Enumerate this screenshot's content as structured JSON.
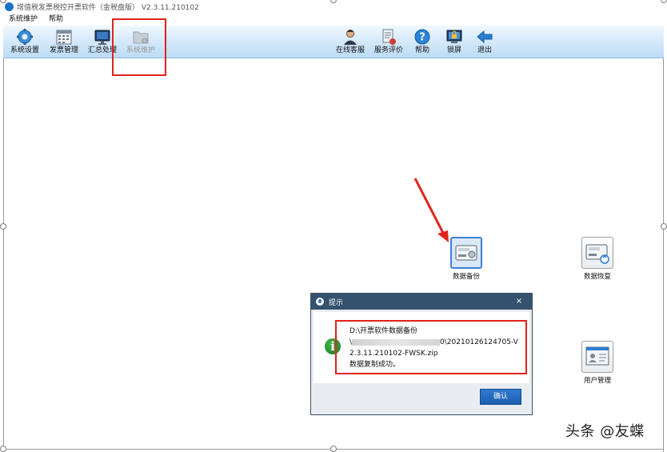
{
  "window": {
    "title": "增值税发票税控开票软件（金税盘版） V2.3.11.210102"
  },
  "menu": [
    {
      "label": "系统维护"
    },
    {
      "label": "帮助"
    }
  ],
  "toolbar": {
    "left": [
      {
        "label": "系统设置",
        "icon": "gear-icon"
      },
      {
        "label": "发票管理",
        "icon": "invoice-calendar-icon"
      },
      {
        "label": "汇总处理",
        "icon": "monitor-icon"
      },
      {
        "label": "系统维护",
        "icon": "folder-icon",
        "disabled": true
      }
    ],
    "right": [
      {
        "label": "在线客服",
        "icon": "support-agent-icon"
      },
      {
        "label": "服务评价",
        "icon": "evaluation-icon"
      },
      {
        "label": "帮助",
        "icon": "help-icon"
      },
      {
        "label": "锁屏",
        "icon": "lock-screen-icon"
      },
      {
        "label": "退出",
        "icon": "exit-arrow-icon"
      }
    ]
  },
  "workspace": {
    "items": [
      {
        "label": "数据备份",
        "icon": "backup-disk-icon",
        "selected": true
      },
      {
        "label": "数据恢复",
        "icon": "restore-disk-icon"
      },
      {
        "label": "用户管理",
        "icon": "user-card-icon"
      }
    ]
  },
  "dialog": {
    "title": "提示",
    "close": "×",
    "message_line1": "D:\\开票软件数据备份",
    "message_line2_prefix": "\\",
    "message_line2_suffix": "0\\20210126124705-V",
    "message_line3": "2.3.11.210102-FWSK.zip",
    "message_line4": "数据复制成功。",
    "ok_label": "确认"
  },
  "watermark": "头条 @友蝶",
  "colors": {
    "annotation_red": "#e2231a",
    "dialog_title": "#34516e",
    "ok_button": "#2066b8"
  }
}
